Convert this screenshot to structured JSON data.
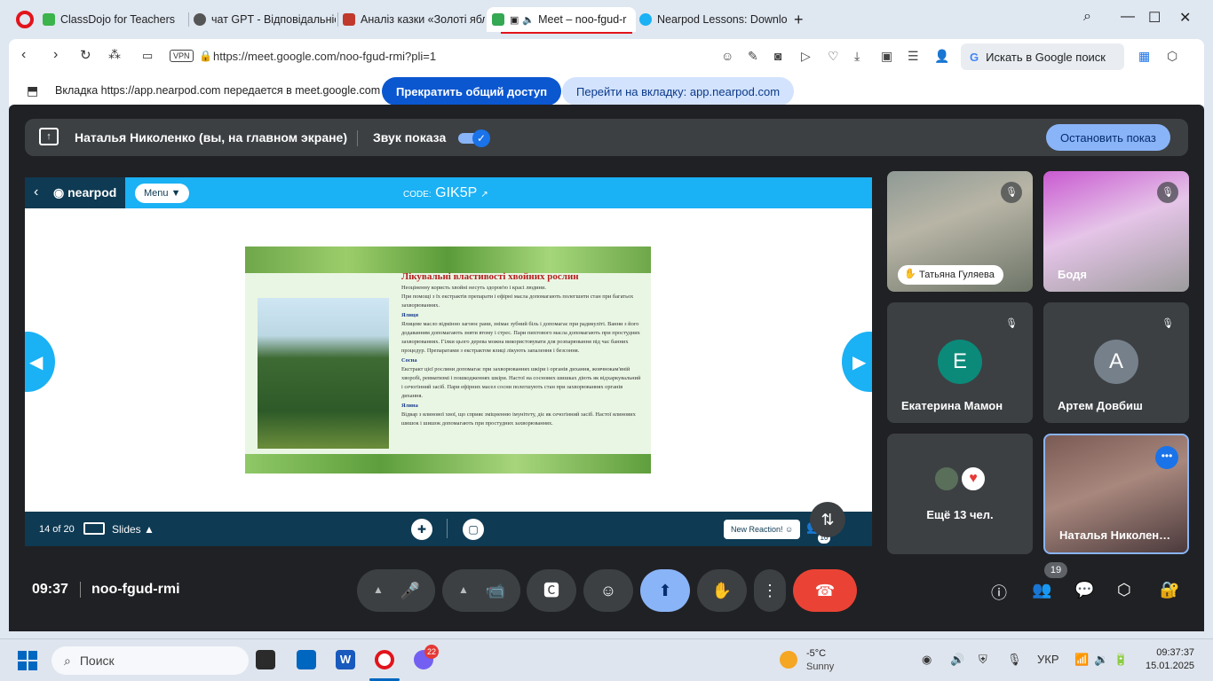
{
  "browser": {
    "tabs": [
      {
        "label": "ClassDojo for Teachers",
        "color": "#3cb44b"
      },
      {
        "label": "чат GPT - Відповідальніст",
        "color": "#555555"
      },
      {
        "label": "Аналіз казки «Золоті ябл",
        "color": "#c0392b"
      },
      {
        "label": "Meet – noo-fgud-r",
        "color": "#34a853"
      },
      {
        "label": "Nearpod Lessons: Downlo",
        "color": "#1ab1f5"
      }
    ],
    "vpn_label": "VPN",
    "url": "https://meet.google.com/noo-fgud-rmi?pli=1",
    "search_label": "Искать в Google поиск"
  },
  "share_banner": {
    "text": "Вкладка https://app.nearpod.com передается в meet.google.com",
    "stop_button": "Прекратить общий доступ",
    "goto_button": "Перейти на вкладку: app.nearpod.com"
  },
  "presenting_bar": {
    "name": "Наталья Николенко (вы, на главном экране)",
    "sound_label": "Звук показа",
    "sound_on": true,
    "stop_button": "Остановить показ"
  },
  "nearpod": {
    "logo": "nearpod",
    "menu_label": "Menu",
    "code_label": "CODE:",
    "code": "GIK5P",
    "page_indicator": "14 of 20",
    "slides_label": "Slides",
    "reaction_label": "New Reaction!",
    "participants_count": "10",
    "slide": {
      "title": "Лікувальні властивості хвойних рослин",
      "paragraphs": [
        {
          "text": "Неоціненну користь хвойні несуть здоров'ю і красі людини.",
          "heading": false
        },
        {
          "text": "При помощі з їх екстрактів препарати і ефірні масла допомагають полегшити стан при багатьох захворюваннях.",
          "heading": false
        },
        {
          "text": "Ялиця",
          "heading": true
        },
        {
          "text": "Ялицеве масло відмінно загоює рани, знімає зубний біль і допомагає при радикуліті. Ванни з його додаванням допомагають зняти втому і стрес. Пари пихтового масла допомагають при простудних захворюваннях. Гілки цього дерева можна використовувати для розпарювання під час банних процедур. Препаратами з екстрактом ялиці лікують запалення і безсоння.",
          "heading": false
        },
        {
          "text": "Сосна",
          "heading": true
        },
        {
          "text": "Екстракт цієї рослини допомагає при захворюваннях шкіри і органів дихання, жовчнокам'яній хворобі, ревматизмі і пошкодженнях шкіри. Настої на соснових шишках діють як відхаркувальний і сечогінний засіб. Пари ефірних масел сосни полегшують стан при захворюваннях органів дихання.",
          "heading": false
        },
        {
          "text": "Ялина",
          "heading": true
        },
        {
          "text": "Відвар з ялинової хвої, що сприяє зміцненню імунітету, діє як сечогінний засіб. Настої ялинових шишок і шишок допомагають при простудних захворюваннях.",
          "heading": false
        }
      ]
    }
  },
  "participants": [
    {
      "name": "Татьяна Гуляева",
      "muted": true,
      "hand_raised": true,
      "video": true
    },
    {
      "name": "Бодя",
      "muted": true,
      "video": true
    },
    {
      "name": "Екатерина Мамон",
      "initial": "Е",
      "avatar_color": "#0b8a7a",
      "muted": true
    },
    {
      "name": "Артем Довбиш",
      "initial": "А",
      "avatar_color": "#75808a",
      "muted": true
    },
    {
      "name": "Ещё 13 чел."
    },
    {
      "name": "Наталья Николен…",
      "video": true,
      "self": true
    }
  ],
  "meeting": {
    "time": "09:37",
    "id": "noo-fgud-rmi",
    "people_count": "19"
  },
  "taskbar": {
    "search_placeholder": "Поиск",
    "viber_badge": "22",
    "weather_temp": "-5°C",
    "weather_cond": "Sunny",
    "language": "УКР",
    "time": "09:37:37",
    "date": "15.01.2025"
  }
}
